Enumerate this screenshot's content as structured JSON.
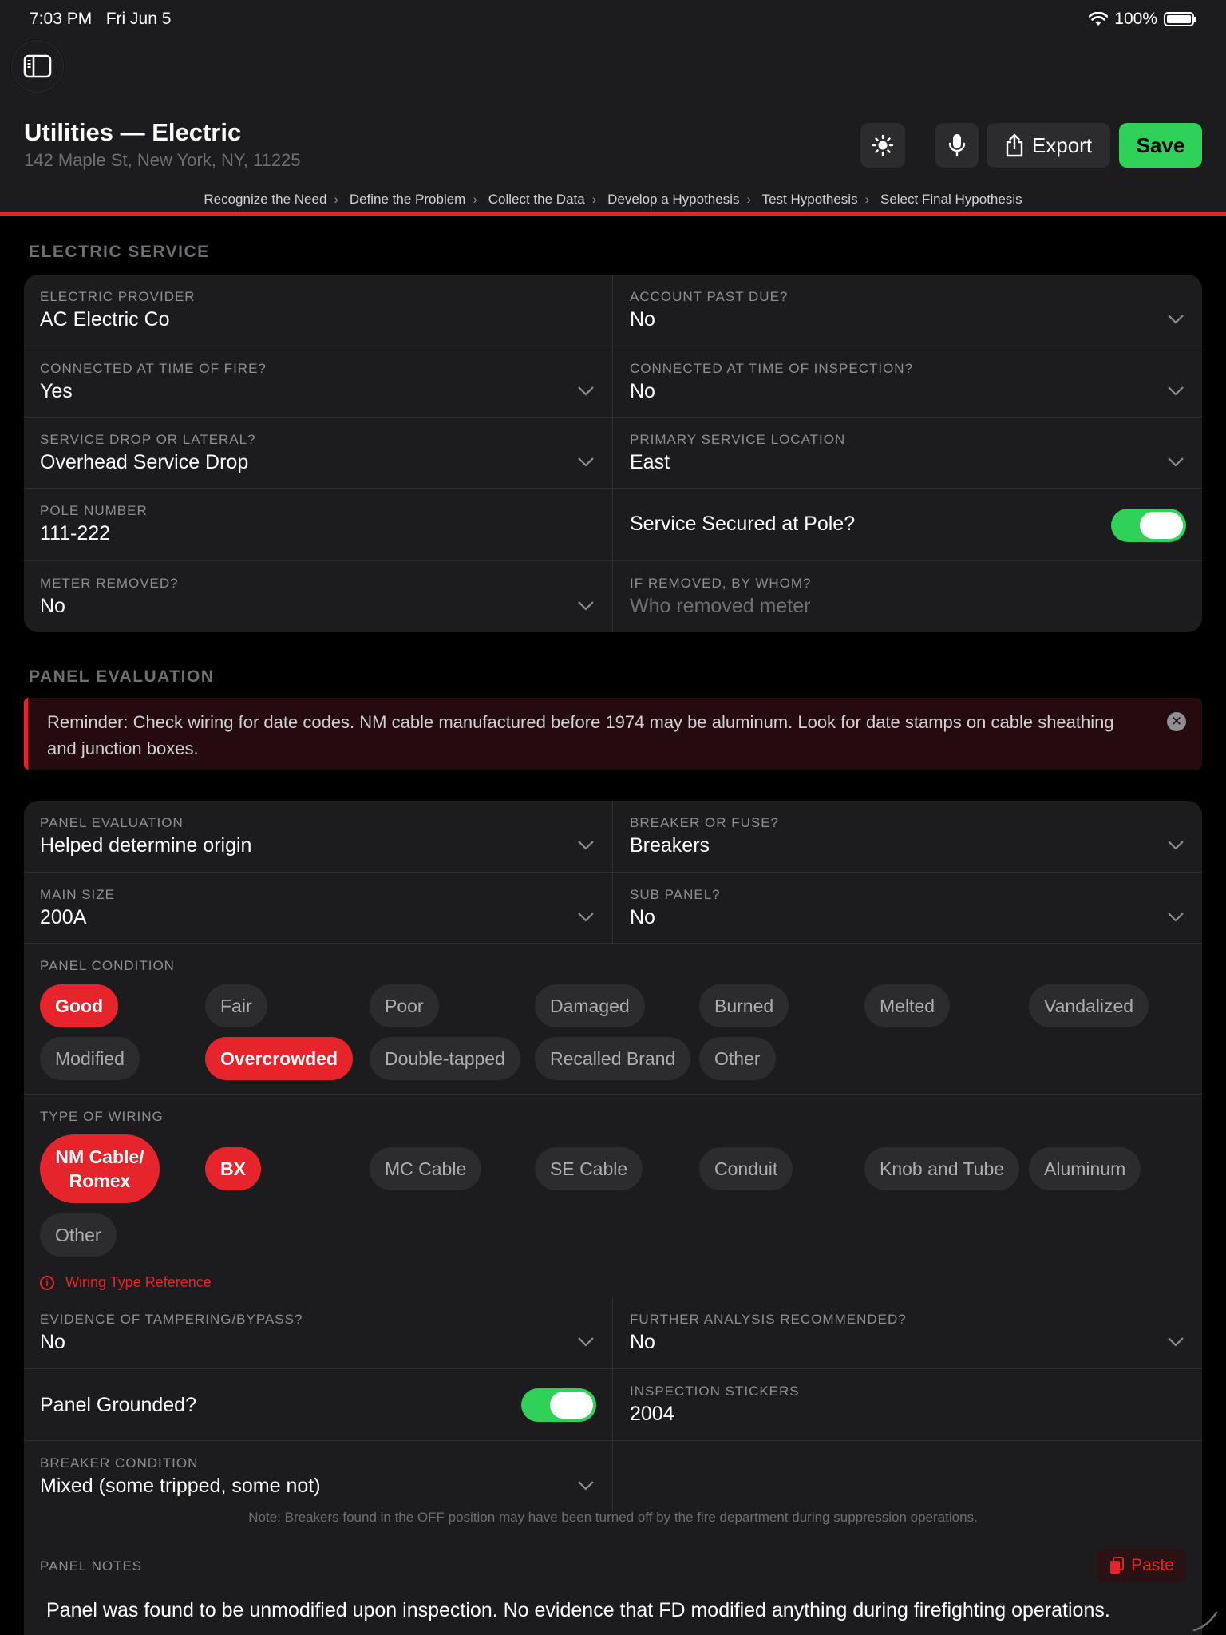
{
  "status_bar": {
    "time": "7:03 PM",
    "date": "Fri Jun 5",
    "battery": "100%"
  },
  "header": {
    "title": "Utilities — Electric",
    "address": "142 Maple St, New York, NY, 11225",
    "export_label": "Export",
    "save_label": "Save",
    "icons": [
      "sidebar-icon",
      "sun-icon",
      "microphone-icon",
      "share-icon"
    ]
  },
  "breadcrumb": [
    "Recognize the Need",
    "Define the Problem",
    "Collect the Data",
    "Develop a Hypothesis",
    "Test Hypothesis",
    "Select Final Hypothesis"
  ],
  "electric_service": {
    "heading": "ELECTRIC SERVICE",
    "provider": {
      "label": "ELECTRIC PROVIDER",
      "value": "AC Electric Co"
    },
    "past_due": {
      "label": "ACCOUNT PAST DUE?",
      "value": "No"
    },
    "connected_fire": {
      "label": "CONNECTED AT TIME OF FIRE?",
      "value": "Yes"
    },
    "connected_inspection": {
      "label": "CONNECTED AT TIME OF INSPECTION?",
      "value": "No"
    },
    "drop_lateral": {
      "label": "SERVICE DROP OR LATERAL?",
      "value": "Overhead Service Drop"
    },
    "primary_location": {
      "label": "PRIMARY SERVICE LOCATION",
      "value": "East"
    },
    "pole_number": {
      "label": "POLE NUMBER",
      "value": "111-222"
    },
    "secured_at_pole": {
      "label": "Service Secured at Pole?",
      "on": true
    },
    "meter_removed": {
      "label": "METER REMOVED?",
      "value": "No"
    },
    "removed_by": {
      "label": "IF REMOVED, BY WHOM?",
      "placeholder": "Who removed meter"
    }
  },
  "panel_evaluation": {
    "heading": "PANEL EVALUATION",
    "reminder": "Reminder: Check wiring for date codes. NM cable manufactured before 1974 may be aluminum. Look for date stamps on cable sheathing and junction boxes.",
    "evaluation": {
      "label": "PANEL EVALUATION",
      "value": "Helped determine origin"
    },
    "breaker_fuse": {
      "label": "BREAKER OR FUSE?",
      "value": "Breakers"
    },
    "main_size": {
      "label": "MAIN SIZE",
      "value": "200A"
    },
    "sub_panel": {
      "label": "SUB PANEL?",
      "value": "No"
    },
    "condition": {
      "label": "PANEL CONDITION",
      "chips": [
        {
          "label": "Good",
          "selected": true
        },
        {
          "label": "Fair",
          "selected": false
        },
        {
          "label": "Poor",
          "selected": false
        },
        {
          "label": "Damaged",
          "selected": false
        },
        {
          "label": "Burned",
          "selected": false
        },
        {
          "label": "Melted",
          "selected": false
        },
        {
          "label": "Vandalized",
          "selected": false
        },
        {
          "label": "Modified",
          "selected": false
        },
        {
          "label": "Overcrowded",
          "selected": true
        },
        {
          "label": "Double-tapped",
          "selected": false
        },
        {
          "label": "Recalled Brand",
          "selected": false
        },
        {
          "label": "Other",
          "selected": false
        }
      ]
    },
    "wiring": {
      "label": "TYPE OF WIRING",
      "chips": [
        {
          "label": "NM Cable/ Romex",
          "selected": true
        },
        {
          "label": "BX",
          "selected": true
        },
        {
          "label": "MC Cable",
          "selected": false
        },
        {
          "label": "SE Cable",
          "selected": false
        },
        {
          "label": "Conduit",
          "selected": false
        },
        {
          "label": "Knob and Tube",
          "selected": false
        },
        {
          "label": "Aluminum",
          "selected": false
        },
        {
          "label": "Other",
          "selected": false
        }
      ],
      "reference_link": "Wiring Type Reference"
    },
    "tampering": {
      "label": "EVIDENCE OF TAMPERING/BYPASS?",
      "value": "No"
    },
    "further_analysis": {
      "label": "FURTHER ANALYSIS RECOMMENDED?",
      "value": "No"
    },
    "grounded": {
      "label": "Panel Grounded?",
      "on": true
    },
    "stickers": {
      "label": "INSPECTION STICKERS",
      "value": "2004"
    },
    "breaker_condition": {
      "label": "BREAKER CONDITION",
      "value": "Mixed (some tripped, some not)"
    },
    "breaker_note": "Note: Breakers found in the OFF position may have been turned off by the fire department during suppression operations.",
    "notes": {
      "label": "PANEL NOTES",
      "paste_label": "Paste",
      "text": "Panel was found to be unmodified upon inspection. No evidence that FD modified anything during firefighting operations."
    }
  },
  "colors": {
    "accent_red": "#e5242b",
    "accent_green": "#30d158",
    "card": "#1c1c1e",
    "background": "#000000"
  }
}
